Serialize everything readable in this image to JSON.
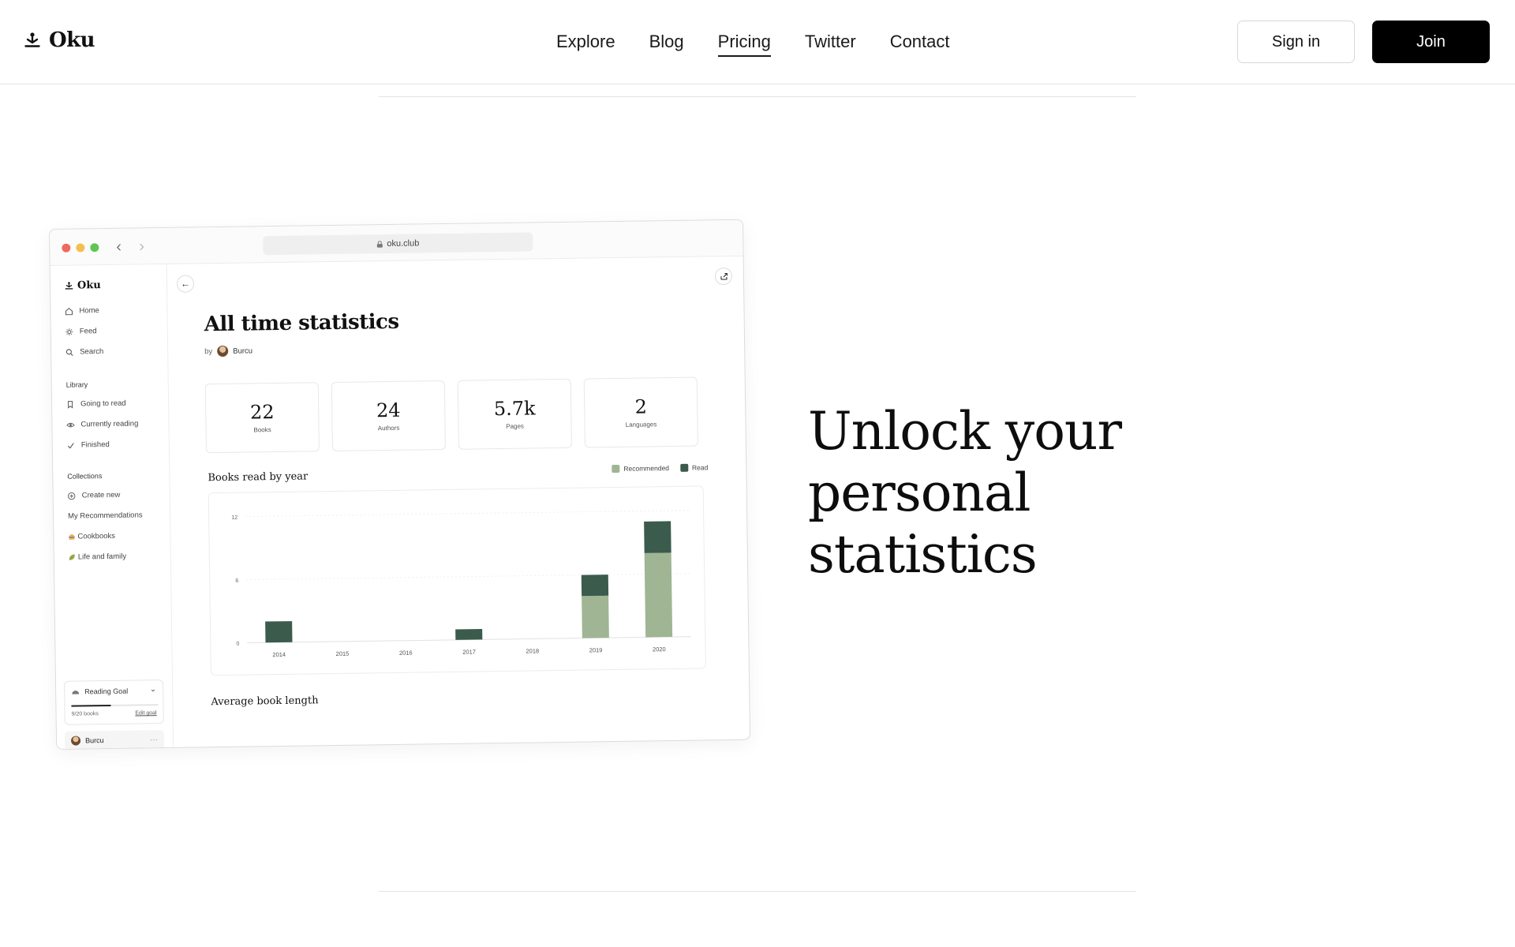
{
  "header": {
    "brand": "Oku",
    "nav": [
      "Explore",
      "Blog",
      "Pricing",
      "Twitter",
      "Contact"
    ],
    "active_nav": "Pricing",
    "sign_in": "Sign in",
    "join": "Join"
  },
  "hero": {
    "headline": "Unlock your personal statistics"
  },
  "mockup": {
    "url": "oku.club",
    "sidebar": {
      "brand": "Oku",
      "nav": [
        {
          "label": "Home",
          "icon": "home-icon"
        },
        {
          "label": "Feed",
          "icon": "sun-icon"
        },
        {
          "label": "Search",
          "icon": "search-icon"
        }
      ],
      "library_heading": "Library",
      "library": [
        {
          "label": "Going to read",
          "icon": "bookmark-icon"
        },
        {
          "label": "Currently reading",
          "icon": "eye-icon"
        },
        {
          "label": "Finished",
          "icon": "check-icon"
        }
      ],
      "collections_heading": "Collections",
      "collections": [
        {
          "label": "Create new",
          "icon": "plus-circle-icon"
        },
        {
          "label": "My Recommendations",
          "icon": ""
        },
        {
          "label": "Cookbooks",
          "icon": "burger-emoji-icon"
        },
        {
          "label": "Life and family",
          "icon": "leaf-emoji-icon"
        }
      ],
      "goal": {
        "title": "Reading Goal",
        "progress": 0.45,
        "count": "9/20 books",
        "edit": "Edit goal"
      },
      "user": "Burcu"
    },
    "page": {
      "title": "All time statistics",
      "by": "by",
      "author": "Burcu",
      "stats": [
        {
          "value": "22",
          "label": "Books"
        },
        {
          "value": "24",
          "label": "Authors"
        },
        {
          "value": "5.7k",
          "label": "Pages"
        },
        {
          "value": "2",
          "label": "Languages"
        }
      ],
      "chart_title": "Books read by year",
      "next_section": "Average book length"
    },
    "colors": {
      "recommended": "#9fb594",
      "read": "#3b5b4d"
    }
  },
  "chart_data": {
    "type": "bar",
    "title": "Books read by year",
    "categories": [
      "2014",
      "2015",
      "2016",
      "2017",
      "2018",
      "2019",
      "2020"
    ],
    "series": [
      {
        "name": "Recommended",
        "values": [
          0,
          0,
          0,
          0,
          0,
          4,
          8
        ]
      },
      {
        "name": "Read",
        "values": [
          2,
          0,
          0,
          1,
          0,
          2,
          3
        ]
      }
    ],
    "stacked": true,
    "yticks": [
      "0",
      "6",
      "12"
    ],
    "ylim": [
      0,
      12
    ],
    "legend_position": "top-right",
    "grid": true
  }
}
